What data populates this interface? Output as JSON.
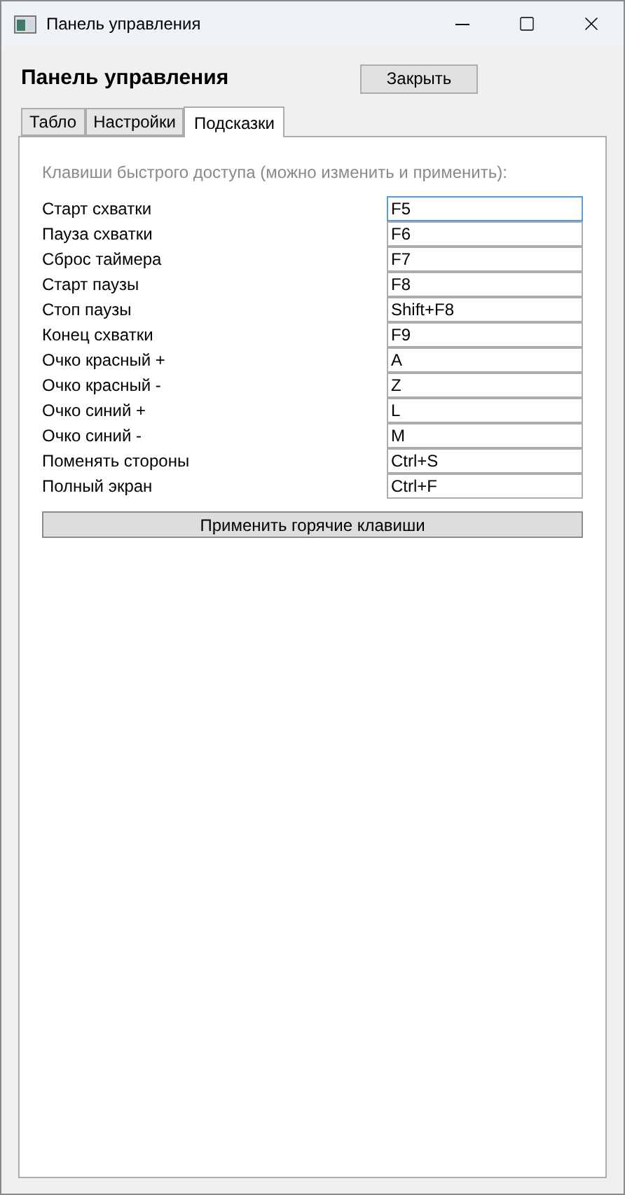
{
  "window": {
    "title": "Панель управления"
  },
  "header": {
    "title": "Панель управления",
    "close_button": "Закрыть"
  },
  "tabs": [
    {
      "label": "Табло",
      "selected": false
    },
    {
      "label": "Настройки",
      "selected": false
    },
    {
      "label": "Подсказки",
      "selected": true
    }
  ],
  "hint": "Клавиши быстрого доступа (можно изменить и применить):",
  "hotkeys": [
    {
      "label": "Старт схватки",
      "value": "F5",
      "focused": true
    },
    {
      "label": "Пауза схватки",
      "value": "F6",
      "focused": false
    },
    {
      "label": "Сброс таймера",
      "value": "F7",
      "focused": false
    },
    {
      "label": "Старт паузы",
      "value": "F8",
      "focused": false
    },
    {
      "label": "Стоп паузы",
      "value": "Shift+F8",
      "focused": false
    },
    {
      "label": "Конец схватки",
      "value": "F9",
      "focused": false
    },
    {
      "label": "Очко красный +",
      "value": "A",
      "focused": false
    },
    {
      "label": "Очко красный -",
      "value": "Z",
      "focused": false
    },
    {
      "label": "Очко синий +",
      "value": "L",
      "focused": false
    },
    {
      "label": "Очко синий -",
      "value": "M",
      "focused": false
    },
    {
      "label": "Поменять стороны",
      "value": "Ctrl+S",
      "focused": false
    },
    {
      "label": "Полный экран",
      "value": "Ctrl+F",
      "focused": false
    }
  ],
  "apply_button": "Применить горячие клавиши"
}
